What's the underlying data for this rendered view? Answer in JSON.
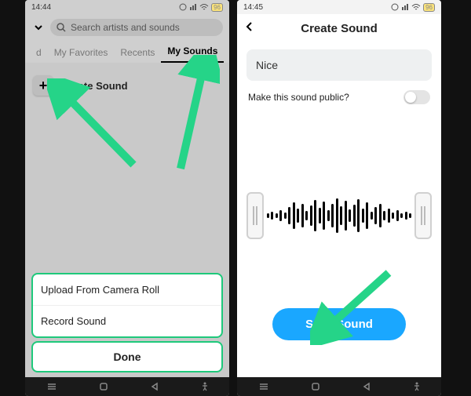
{
  "left": {
    "status": {
      "time": "14:44",
      "battery": "96"
    },
    "search_placeholder": "Search artists and sounds",
    "tabs": {
      "d": "d",
      "fav": "My Favorites",
      "recents": "Recents",
      "mysounds": "My Sounds"
    },
    "create_label": "Create Sound",
    "sheet": {
      "upload": "Upload From Camera Roll",
      "record": "Record Sound",
      "done": "Done"
    }
  },
  "right": {
    "status": {
      "time": "14:45",
      "battery": "96"
    },
    "title": "Create Sound",
    "sound_name": "Nice",
    "public_label": "Make this sound public?",
    "save_label": "Save Sound"
  }
}
